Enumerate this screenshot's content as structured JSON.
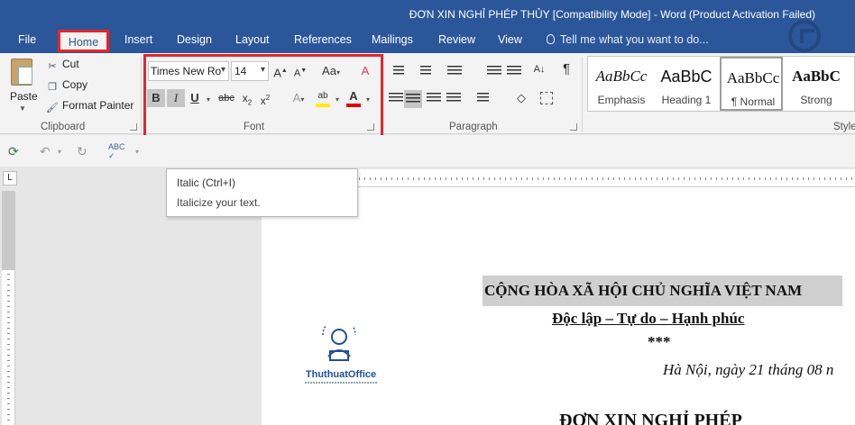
{
  "window": {
    "title": "ĐƠN XIN NGHỈ PHÉP THỦY [Compatibility Mode] - Word (Product Activation Failed)"
  },
  "tabs": [
    {
      "label": "File"
    },
    {
      "label": "Home"
    },
    {
      "label": "Insert"
    },
    {
      "label": "Design"
    },
    {
      "label": "Layout"
    },
    {
      "label": "References"
    },
    {
      "label": "Mailings"
    },
    {
      "label": "Review"
    },
    {
      "label": "View"
    }
  ],
  "tell_me": {
    "placeholder": "Tell me what you want to do..."
  },
  "clipboard": {
    "paste_label": "Paste",
    "cut_label": "Cut",
    "copy_label": "Copy",
    "format_painter_label": "Format Painter",
    "group_label": "Clipboard"
  },
  "font": {
    "name": "Times New Ro",
    "size": "14",
    "bold_label": "B",
    "italic_label": "I",
    "underline_label": "U",
    "strike_label": "abc",
    "group_label": "Font"
  },
  "paragraph": {
    "group_label": "Paragraph"
  },
  "styles": {
    "items": [
      {
        "sample": "AaBbCc",
        "name": "Emphasis"
      },
      {
        "sample": "AaBbC",
        "name": "Heading 1"
      },
      {
        "sample": "AaBbCc",
        "name": "¶ Normal"
      },
      {
        "sample": "AaBbC",
        "name": "Strong"
      }
    ],
    "group_label": "Style"
  },
  "tooltip": {
    "title": "Italic (Ctrl+I)",
    "description": "Italicize your text."
  },
  "document": {
    "header": "CỘNG HÒA XÃ HỘI CHỦ NGHĨA VIỆT NAM",
    "subheader": "Độc lập – Tự do – Hạnh phúc",
    "stars": "***",
    "date": "Hà Nội, ngày 21 tháng 08 n",
    "heading": "ĐƠN XIN NGHỈ PHÉP",
    "logo_text": "ThuthuatOffice"
  },
  "colors": {
    "brand": "#2b579a",
    "highlight_outline": "#e3262c",
    "font_color_bar": "#e00000",
    "highlight_color_bar": "#ffee00"
  }
}
